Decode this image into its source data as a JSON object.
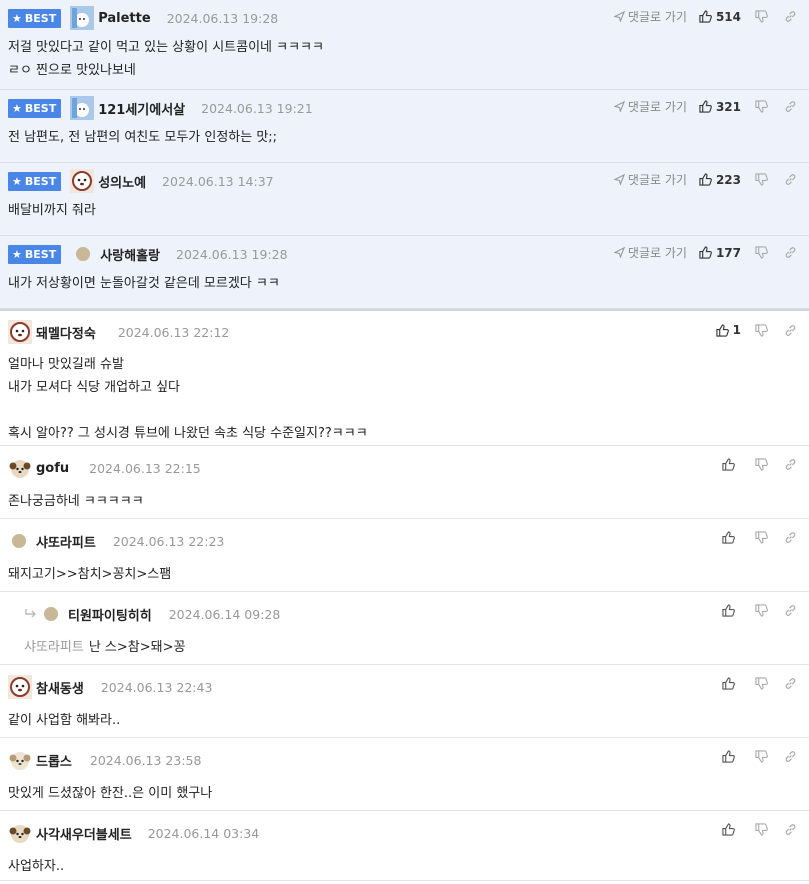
{
  "labels": {
    "best": "BEST",
    "reply_link": "댓글로 가기"
  },
  "best_comments": [
    {
      "nick": "Palette",
      "date": "2024.06.13 19:28",
      "likes": "514",
      "lines": [
        "저걸 맛있다고 같이 먹고 있는 상황이 시트콤이네 ㅋㅋㅋㅋ",
        "ㄹㅇ 찐으로 맛있나보네"
      ]
    },
    {
      "nick": "121세기에서살",
      "date": "2024.06.13 19:21",
      "likes": "321",
      "lines": [
        "전 남편도, 전 남편의 여친도 모두가 인정하는 맛;;"
      ]
    },
    {
      "nick": "성의노예",
      "date": "2024.06.13 14:37",
      "likes": "223",
      "lines": [
        "배달비까지 줘라"
      ]
    },
    {
      "nick": "사랑해홀랑",
      "date": "2024.06.13 19:28",
      "likes": "177",
      "lines": [
        "내가 저상황이면 눈돌아갈것 같은데 모르겠다 ㅋㅋ"
      ]
    }
  ],
  "comments": [
    {
      "nick": "돼멜다정숙",
      "date": "2024.06.13 22:12",
      "likes": "1",
      "lines": [
        "얼마나 맛있길래 슈발",
        "내가 모셔다 식당 개업하고 싶다",
        "",
        "혹시 알아?? 그 성시경 튜브에 나왔던 속초 식당 수준일지??ㅋㅋㅋ"
      ]
    },
    {
      "nick": "gofu",
      "date": "2024.06.13 22:15",
      "likes": "",
      "lines": [
        "존나궁금하네 ㅋㅋㅋㅋㅋ"
      ]
    },
    {
      "nick": "샤또라피트",
      "date": "2024.06.13 22:23",
      "likes": "",
      "lines": [
        "돼지고기>>참치>꽁치>스팸"
      ]
    },
    {
      "nick": "티원파이팅히히",
      "date": "2024.06.14 09:28",
      "likes": "",
      "mention": "샤또라피트",
      "lines": [
        "난 스>참>돼>꽁"
      ]
    },
    {
      "nick": "참새동생",
      "date": "2024.06.13 22:43",
      "likes": "",
      "lines": [
        "같이 사업함 해봐라.."
      ]
    },
    {
      "nick": "드롭스",
      "date": "2024.06.13 23:58",
      "likes": "",
      "lines": [
        "맛있게 드셨잖아 한잔..은 이미 했구나"
      ]
    },
    {
      "nick": "사각새우더블세트",
      "date": "2024.06.14 03:34",
      "likes": "",
      "lines": [
        "사업하자.."
      ]
    }
  ]
}
